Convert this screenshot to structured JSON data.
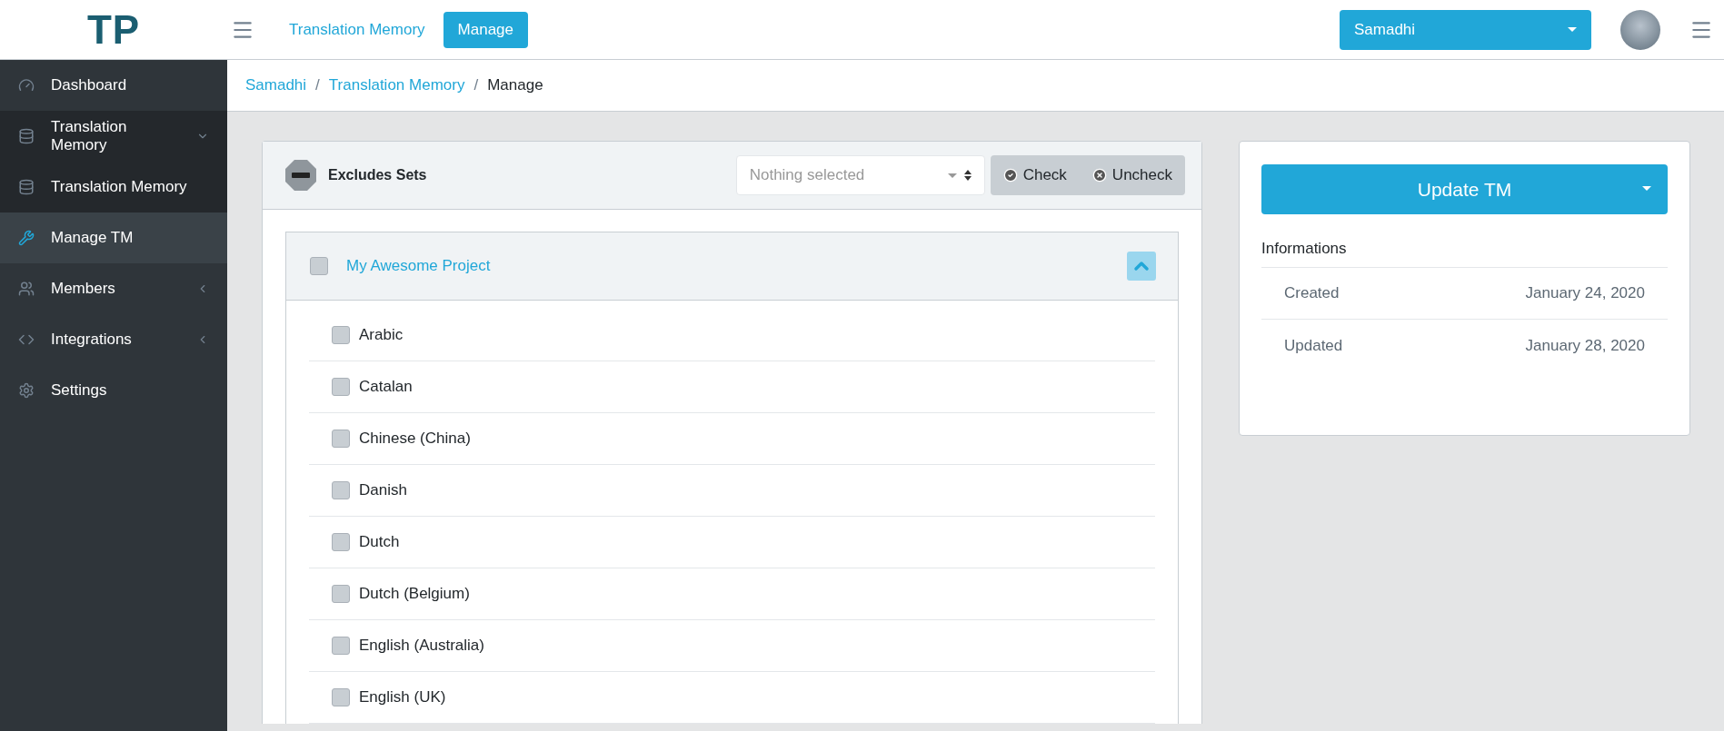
{
  "header": {
    "logo": "TP",
    "nav": [
      {
        "label": "Translation Memory",
        "selected": false
      },
      {
        "label": "Manage",
        "selected": true
      }
    ],
    "project_select": "Samadhi"
  },
  "sidebar": {
    "items": [
      {
        "label": "Dashboard",
        "selected": false
      },
      {
        "label": "Translation Memory",
        "selected": false,
        "expanded": true,
        "children": [
          {
            "label": "Translation Memory",
            "selected": false
          },
          {
            "label": "Manage TM",
            "selected": true
          }
        ]
      },
      {
        "label": "Members",
        "selected": false,
        "expanded": false
      },
      {
        "label": "Integrations",
        "selected": false,
        "expanded": false
      },
      {
        "label": "Settings",
        "selected": false
      }
    ]
  },
  "breadcrumb": [
    {
      "label": "Samadhi",
      "link": true
    },
    {
      "separator": "/",
      "label": "Translation Memory",
      "link": true
    },
    {
      "separator": "/",
      "label": "Manage",
      "link": false
    }
  ],
  "excludes": {
    "title": "Excludes Sets",
    "select_placeholder": "Nothing selected",
    "check_label": "Check",
    "uncheck_label": "Uncheck",
    "project": {
      "name": "My Awesome Project",
      "checked": false,
      "expanded": true
    },
    "languages": [
      {
        "name": "Arabic",
        "checked": false
      },
      {
        "name": "Catalan",
        "checked": false
      },
      {
        "name": "Chinese (China)",
        "checked": false
      },
      {
        "name": "Danish",
        "checked": false
      },
      {
        "name": "Dutch",
        "checked": false
      },
      {
        "name": "Dutch (Belgium)",
        "checked": false
      },
      {
        "name": "English (Australia)",
        "checked": false
      },
      {
        "name": "English (UK)",
        "checked": false
      }
    ]
  },
  "info": {
    "update_button": "Update TM",
    "title": "Informations",
    "rows": [
      {
        "label": "Created",
        "value": "January 24, 2020"
      },
      {
        "label": "Updated",
        "value": "January 28, 2020"
      }
    ]
  }
}
